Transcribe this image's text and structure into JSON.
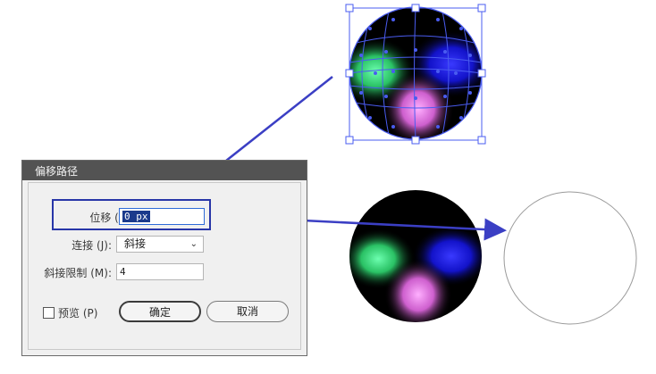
{
  "dialog": {
    "title": "偏移路径",
    "offset_label": "位移 (O):",
    "offset_value": "0 px",
    "join_label": "连接 (J):",
    "join_value": "斜接",
    "miter_label": "斜接限制 (M):",
    "miter_value": "4",
    "preview_label": "预览 (P)",
    "preview_checked": false,
    "ok_label": "确定",
    "cancel_label": "取消"
  },
  "colors": {
    "arrow": "#3b3fc4",
    "selection": "#4a5cf0",
    "highlight_box": "#2836a8",
    "glow_green": "#3dff8a",
    "glow_blue": "#2020ff",
    "glow_pink": "#ff7bff"
  }
}
